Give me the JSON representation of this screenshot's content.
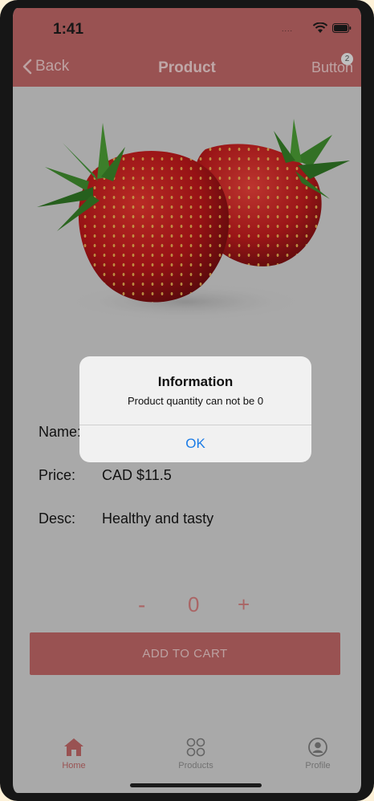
{
  "status_bar": {
    "time": "1:41",
    "signal_dots": "....",
    "wifi_icon": "wifi-icon",
    "battery_icon": "battery-icon"
  },
  "nav": {
    "back_label": "Back",
    "title": "Product",
    "right_button_label": "Button",
    "badge_count": "2"
  },
  "product": {
    "image": "strawberries",
    "name_label": "Name:",
    "name_value": "",
    "price_label": "Price:",
    "price_value": "CAD $11.5",
    "desc_label": "Desc:",
    "desc_value": "Healthy and tasty"
  },
  "quantity": {
    "minus": "-",
    "value": "0",
    "plus": "+"
  },
  "add_to_cart_label": "ADD TO CART",
  "tabs": [
    {
      "label": "Home",
      "icon": "home-icon",
      "active": true
    },
    {
      "label": "Products",
      "icon": "grid-icon",
      "active": false
    },
    {
      "label": "Profile",
      "icon": "profile-icon",
      "active": false
    }
  ],
  "alert": {
    "title": "Information",
    "message": "Product quantity can not be 0",
    "ok_label": "OK"
  },
  "colors": {
    "primary": "#bb6464",
    "alert_button": "#1a7be6",
    "background": "#cfcfcf"
  }
}
